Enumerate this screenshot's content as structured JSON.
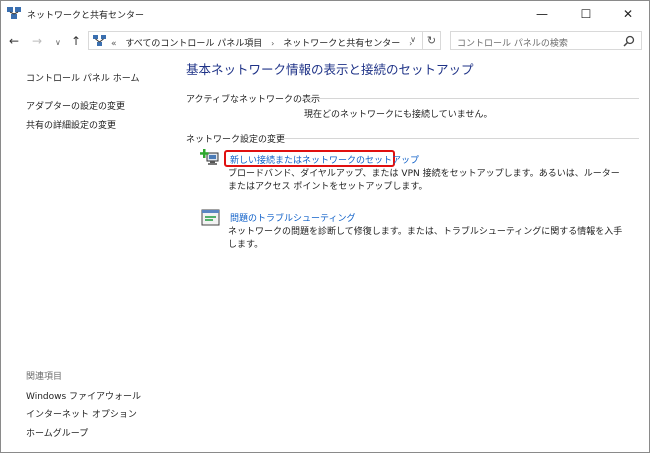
{
  "window": {
    "title": "ネットワークと共有センター"
  },
  "caption": {
    "minimize": "—",
    "maximize": "☐",
    "close": "✕"
  },
  "nav": {
    "back": "←",
    "forward": "→",
    "history": "∨",
    "up": "↑"
  },
  "address": {
    "lead": "«",
    "crumbs": [
      "すべてのコントロール パネル項目",
      "ネットワークと共有センター"
    ],
    "separator": "›",
    "dropdown": "∨",
    "refresh": "↻"
  },
  "search": {
    "placeholder": "コントロール パネルの検索"
  },
  "sidebar": {
    "home": "コントロール パネル ホーム",
    "items": [
      "アダプターの設定の変更",
      "共有の詳細設定の変更"
    ],
    "related_title": "関連項目",
    "related": [
      "Windows ファイアウォール",
      "インターネット オプション",
      "ホームグループ"
    ]
  },
  "main": {
    "heading": "基本ネットワーク情報の表示と接続のセットアップ",
    "active_title": "アクティブなネットワークの表示",
    "active_status": "現在どのネットワークにも接続していません。",
    "change_title": "ネットワーク設定の変更",
    "tasks": [
      {
        "link": "新しい接続またはネットワークのセットアップ",
        "desc": "ブロードバンド、ダイヤルアップ、または VPN 接続をセットアップします。あるいは、ルーターまたはアクセス ポイントをセットアップします。"
      },
      {
        "link": "問題のトラブルシューティング",
        "desc": "ネットワークの問題を診断して修復します。または、トラブルシューティングに関する情報を入手します。"
      }
    ]
  }
}
